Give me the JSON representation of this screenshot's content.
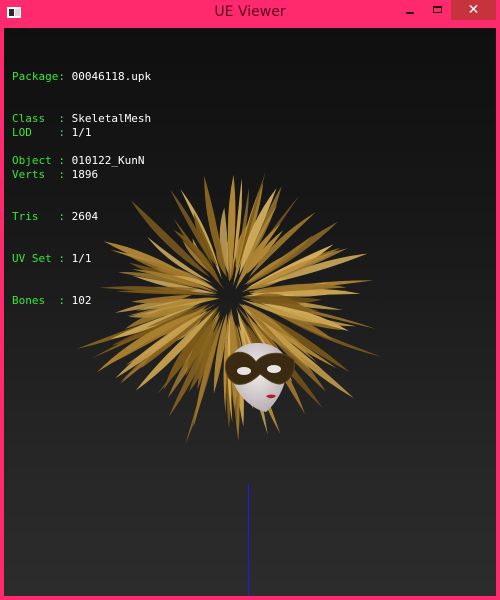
{
  "window": {
    "title": "UE Viewer",
    "buttons": {
      "minimize": "",
      "maximize": "",
      "close": "✕"
    }
  },
  "info_top": [
    {
      "label": "Package",
      "value": "00046118.upk"
    },
    {
      "label": "Class  ",
      "value": "SkeletalMesh"
    },
    {
      "label": "Object ",
      "value": "010122_KunN"
    }
  ],
  "info_bottom": [
    {
      "label": "LOD    ",
      "value": "1/1"
    },
    {
      "label": "Verts  ",
      "value": "1896"
    },
    {
      "label": "Tris   ",
      "value": "2604"
    },
    {
      "label": "UV Set ",
      "value": "1/1"
    },
    {
      "label": "Bones  ",
      "value": "102"
    }
  ],
  "colors": {
    "frame": "#ff2a6d",
    "label_green": "#39e639",
    "value_white": "#ffffff",
    "axis_blue": "#1a1aff",
    "feather_gold": "#a67f2c"
  },
  "icons": {
    "app": "window-icon",
    "minimize": "minimize-icon",
    "maximize": "maximize-icon",
    "close": "close-icon"
  }
}
